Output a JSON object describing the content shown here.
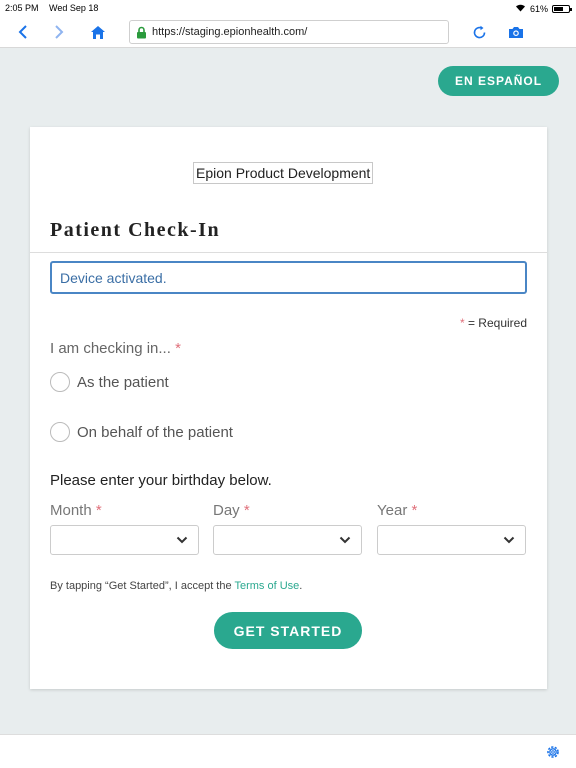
{
  "status_bar": {
    "time": "2:05 PM",
    "date": "Wed Sep 18",
    "battery": "61%"
  },
  "browser": {
    "url": "https://staging.epionhealth.com/"
  },
  "language_button": "EN ESPAÑOL",
  "card": {
    "org_name": "Epion Product Development",
    "title": "Patient Check-In",
    "alert": "Device activated.",
    "required_mark": "*",
    "required_text": " = Required",
    "question": "I am checking in...",
    "options": [
      {
        "label": "As the patient",
        "selected": false
      },
      {
        "label": "On behalf of the patient",
        "selected": false
      }
    ],
    "birthday_prompt": "Please enter your birthday below.",
    "fields": {
      "month": {
        "label": "Month",
        "value": ""
      },
      "day": {
        "label": "Day",
        "value": ""
      },
      "year": {
        "label": "Year",
        "value": ""
      }
    },
    "terms_prefix": "By tapping “Get Started”, I accept the ",
    "terms_link": "Terms of Use",
    "terms_suffix": ".",
    "submit_label": "GET STARTED"
  },
  "colors": {
    "accent": "#2aa88f",
    "alert_border": "#4a86c5",
    "required": "#e0707b",
    "background": "#e8edee"
  }
}
